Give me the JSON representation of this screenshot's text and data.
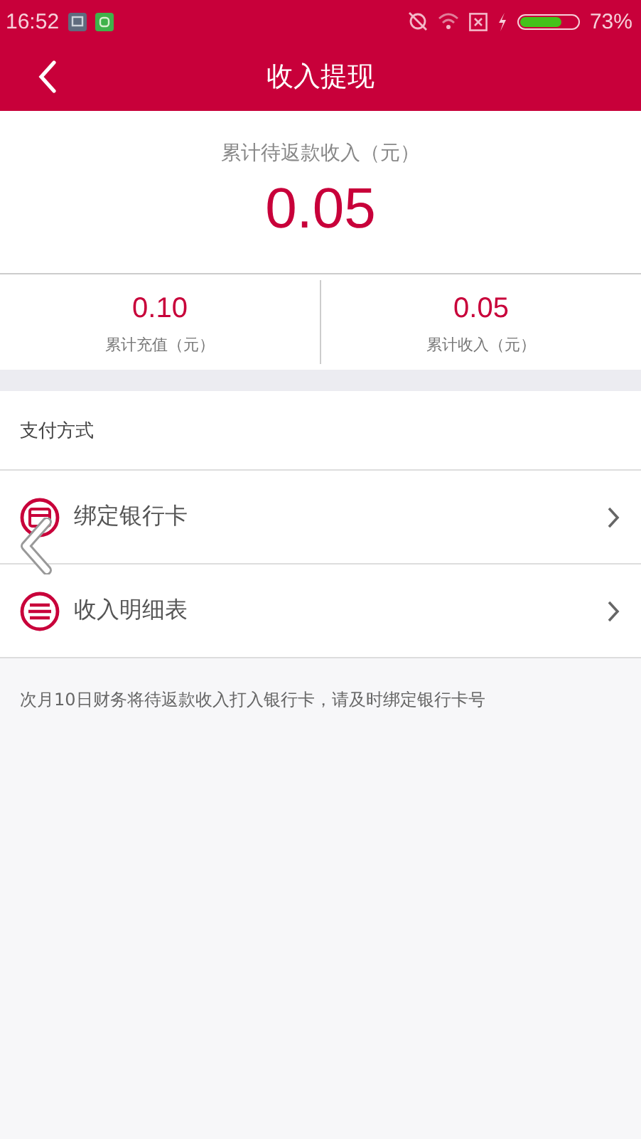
{
  "status_bar": {
    "time": "16:52",
    "battery": "73%"
  },
  "header": {
    "title": "收入提现"
  },
  "summary": {
    "label": "累计待返款收入（元）",
    "value": "0.05"
  },
  "stats": [
    {
      "value": "0.10",
      "label": "累计充值（元）"
    },
    {
      "value": "0.05",
      "label": "累计收入（元）"
    }
  ],
  "section": {
    "title": "支付方式"
  },
  "menu": [
    {
      "kind": "card",
      "label": "绑定银行卡"
    },
    {
      "kind": "list",
      "label": "收入明细表"
    }
  ],
  "note": "次月10日财务将待返款收入打入银行卡，请及时绑定银行卡号"
}
